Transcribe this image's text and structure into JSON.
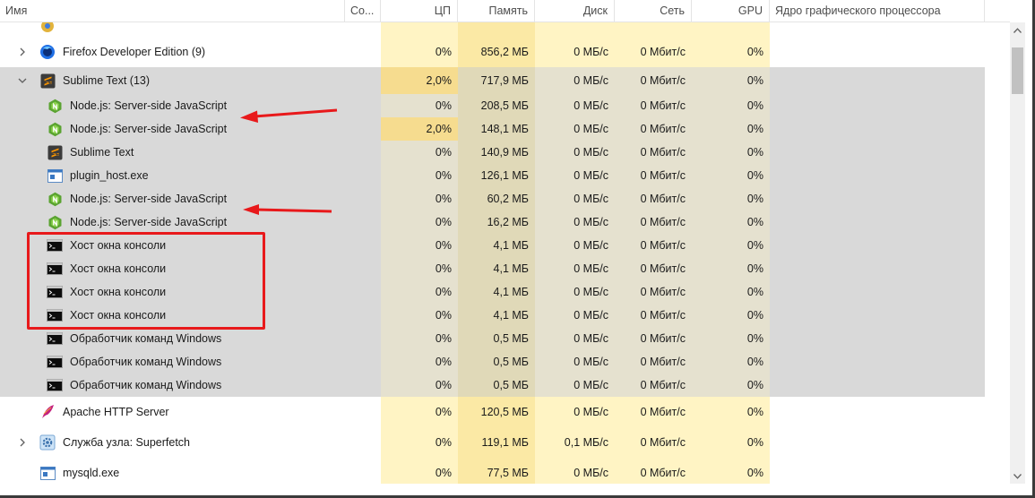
{
  "columns": {
    "name": "Имя",
    "status": "Со...",
    "cpu": "ЦП",
    "memory": "Память",
    "disk": "Диск",
    "network": "Сеть",
    "gpu": "GPU",
    "gpu_engine": "Ядро графического процессора"
  },
  "rows": [
    {
      "name": "",
      "icon": "chrome-icon",
      "level": 0,
      "expander": "",
      "shaded": false,
      "cpu": "",
      "mem": "",
      "disk": "",
      "net": "",
      "gpu": "",
      "gpu_engine": ""
    },
    {
      "name": "Firefox Developer Edition (9)",
      "icon": "firefox-icon",
      "level": 0,
      "expander": "collapsed",
      "shaded": false,
      "cpu": "0%",
      "mem": "856,2 МБ",
      "disk": "0 МБ/с",
      "net": "0 Мбит/с",
      "gpu": "0%",
      "gpu_engine": ""
    },
    {
      "name": "Sublime Text (13)",
      "icon": "sublime-icon",
      "level": 0,
      "expander": "expanded",
      "shaded": true,
      "cpu": "2,0%",
      "mem": "717,9 МБ",
      "disk": "0 МБ/с",
      "net": "0 Мбит/с",
      "gpu": "0%",
      "gpu_engine": ""
    },
    {
      "name": "Node.js: Server-side JavaScript",
      "icon": "nodejs-icon",
      "level": 1,
      "expander": "",
      "shaded": true,
      "cpu": "0%",
      "mem": "208,5 МБ",
      "disk": "0 МБ/с",
      "net": "0 Мбит/с",
      "gpu": "0%",
      "gpu_engine": ""
    },
    {
      "name": "Node.js: Server-side JavaScript",
      "icon": "nodejs-icon",
      "level": 1,
      "expander": "",
      "shaded": true,
      "cpu": "2,0%",
      "mem": "148,1 МБ",
      "disk": "0 МБ/с",
      "net": "0 Мбит/с",
      "gpu": "0%",
      "gpu_engine": ""
    },
    {
      "name": "Sublime Text",
      "icon": "sublime-icon",
      "level": 1,
      "expander": "",
      "shaded": true,
      "cpu": "0%",
      "mem": "140,9 МБ",
      "disk": "0 МБ/с",
      "net": "0 Мбит/с",
      "gpu": "0%",
      "gpu_engine": ""
    },
    {
      "name": "plugin_host.exe",
      "icon": "exe-icon",
      "level": 1,
      "expander": "",
      "shaded": true,
      "cpu": "0%",
      "mem": "126,1 МБ",
      "disk": "0 МБ/с",
      "net": "0 Мбит/с",
      "gpu": "0%",
      "gpu_engine": ""
    },
    {
      "name": "Node.js: Server-side JavaScript",
      "icon": "nodejs-icon",
      "level": 1,
      "expander": "",
      "shaded": true,
      "cpu": "0%",
      "mem": "60,2 МБ",
      "disk": "0 МБ/с",
      "net": "0 Мбит/с",
      "gpu": "0%",
      "gpu_engine": ""
    },
    {
      "name": "Node.js: Server-side JavaScript",
      "icon": "nodejs-icon",
      "level": 1,
      "expander": "",
      "shaded": true,
      "cpu": "0%",
      "mem": "16,2 МБ",
      "disk": "0 МБ/с",
      "net": "0 Мбит/с",
      "gpu": "0%",
      "gpu_engine": ""
    },
    {
      "name": "Хост окна консоли",
      "icon": "console-icon",
      "level": 1,
      "expander": "",
      "shaded": true,
      "cpu": "0%",
      "mem": "4,1 МБ",
      "disk": "0 МБ/с",
      "net": "0 Мбит/с",
      "gpu": "0%",
      "gpu_engine": ""
    },
    {
      "name": "Хост окна консоли",
      "icon": "console-icon",
      "level": 1,
      "expander": "",
      "shaded": true,
      "cpu": "0%",
      "mem": "4,1 МБ",
      "disk": "0 МБ/с",
      "net": "0 Мбит/с",
      "gpu": "0%",
      "gpu_engine": ""
    },
    {
      "name": "Хост окна консоли",
      "icon": "console-icon",
      "level": 1,
      "expander": "",
      "shaded": true,
      "cpu": "0%",
      "mem": "4,1 МБ",
      "disk": "0 МБ/с",
      "net": "0 Мбит/с",
      "gpu": "0%",
      "gpu_engine": ""
    },
    {
      "name": "Хост окна консоли",
      "icon": "console-icon",
      "level": 1,
      "expander": "",
      "shaded": true,
      "cpu": "0%",
      "mem": "4,1 МБ",
      "disk": "0 МБ/с",
      "net": "0 Мбит/с",
      "gpu": "0%",
      "gpu_engine": ""
    },
    {
      "name": "Обработчик команд Windows",
      "icon": "console-icon",
      "level": 1,
      "expander": "",
      "shaded": true,
      "cpu": "0%",
      "mem": "0,5 МБ",
      "disk": "0 МБ/с",
      "net": "0 Мбит/с",
      "gpu": "0%",
      "gpu_engine": ""
    },
    {
      "name": "Обработчик команд Windows",
      "icon": "console-icon",
      "level": 1,
      "expander": "",
      "shaded": true,
      "cpu": "0%",
      "mem": "0,5 МБ",
      "disk": "0 МБ/с",
      "net": "0 Мбит/с",
      "gpu": "0%",
      "gpu_engine": ""
    },
    {
      "name": "Обработчик команд Windows",
      "icon": "console-icon",
      "level": 1,
      "expander": "",
      "shaded": true,
      "cpu": "0%",
      "mem": "0,5 МБ",
      "disk": "0 МБ/с",
      "net": "0 Мбит/с",
      "gpu": "0%",
      "gpu_engine": ""
    },
    {
      "name": "Apache HTTP Server",
      "icon": "apache-feather-icon",
      "level": 0,
      "expander": "",
      "shaded": false,
      "cpu": "0%",
      "mem": "120,5 МБ",
      "disk": "0 МБ/с",
      "net": "0 Мбит/с",
      "gpu": "0%",
      "gpu_engine": ""
    },
    {
      "name": "Служба узла: Superfetch",
      "icon": "gear-icon",
      "level": 0,
      "expander": "collapsed",
      "shaded": false,
      "cpu": "0%",
      "mem": "119,1 МБ",
      "disk": "0,1 МБ/с",
      "net": "0 Мбит/с",
      "gpu": "0%",
      "gpu_engine": ""
    },
    {
      "name": "mysqld.exe",
      "icon": "exe-icon",
      "level": 0,
      "expander": "",
      "shaded": false,
      "cpu": "0%",
      "mem": "77,5 МБ",
      "disk": "0 МБ/с",
      "net": "0 Мбит/с",
      "gpu": "0%",
      "gpu_engine": ""
    }
  ],
  "colors": {
    "heat_light": "#fff4c4",
    "heat_mid": "#fbe9a5",
    "heat_cpu_active": "#f6dc8f",
    "shaded_row": "#d9d9d9",
    "annotation_red": "#e8191b"
  }
}
